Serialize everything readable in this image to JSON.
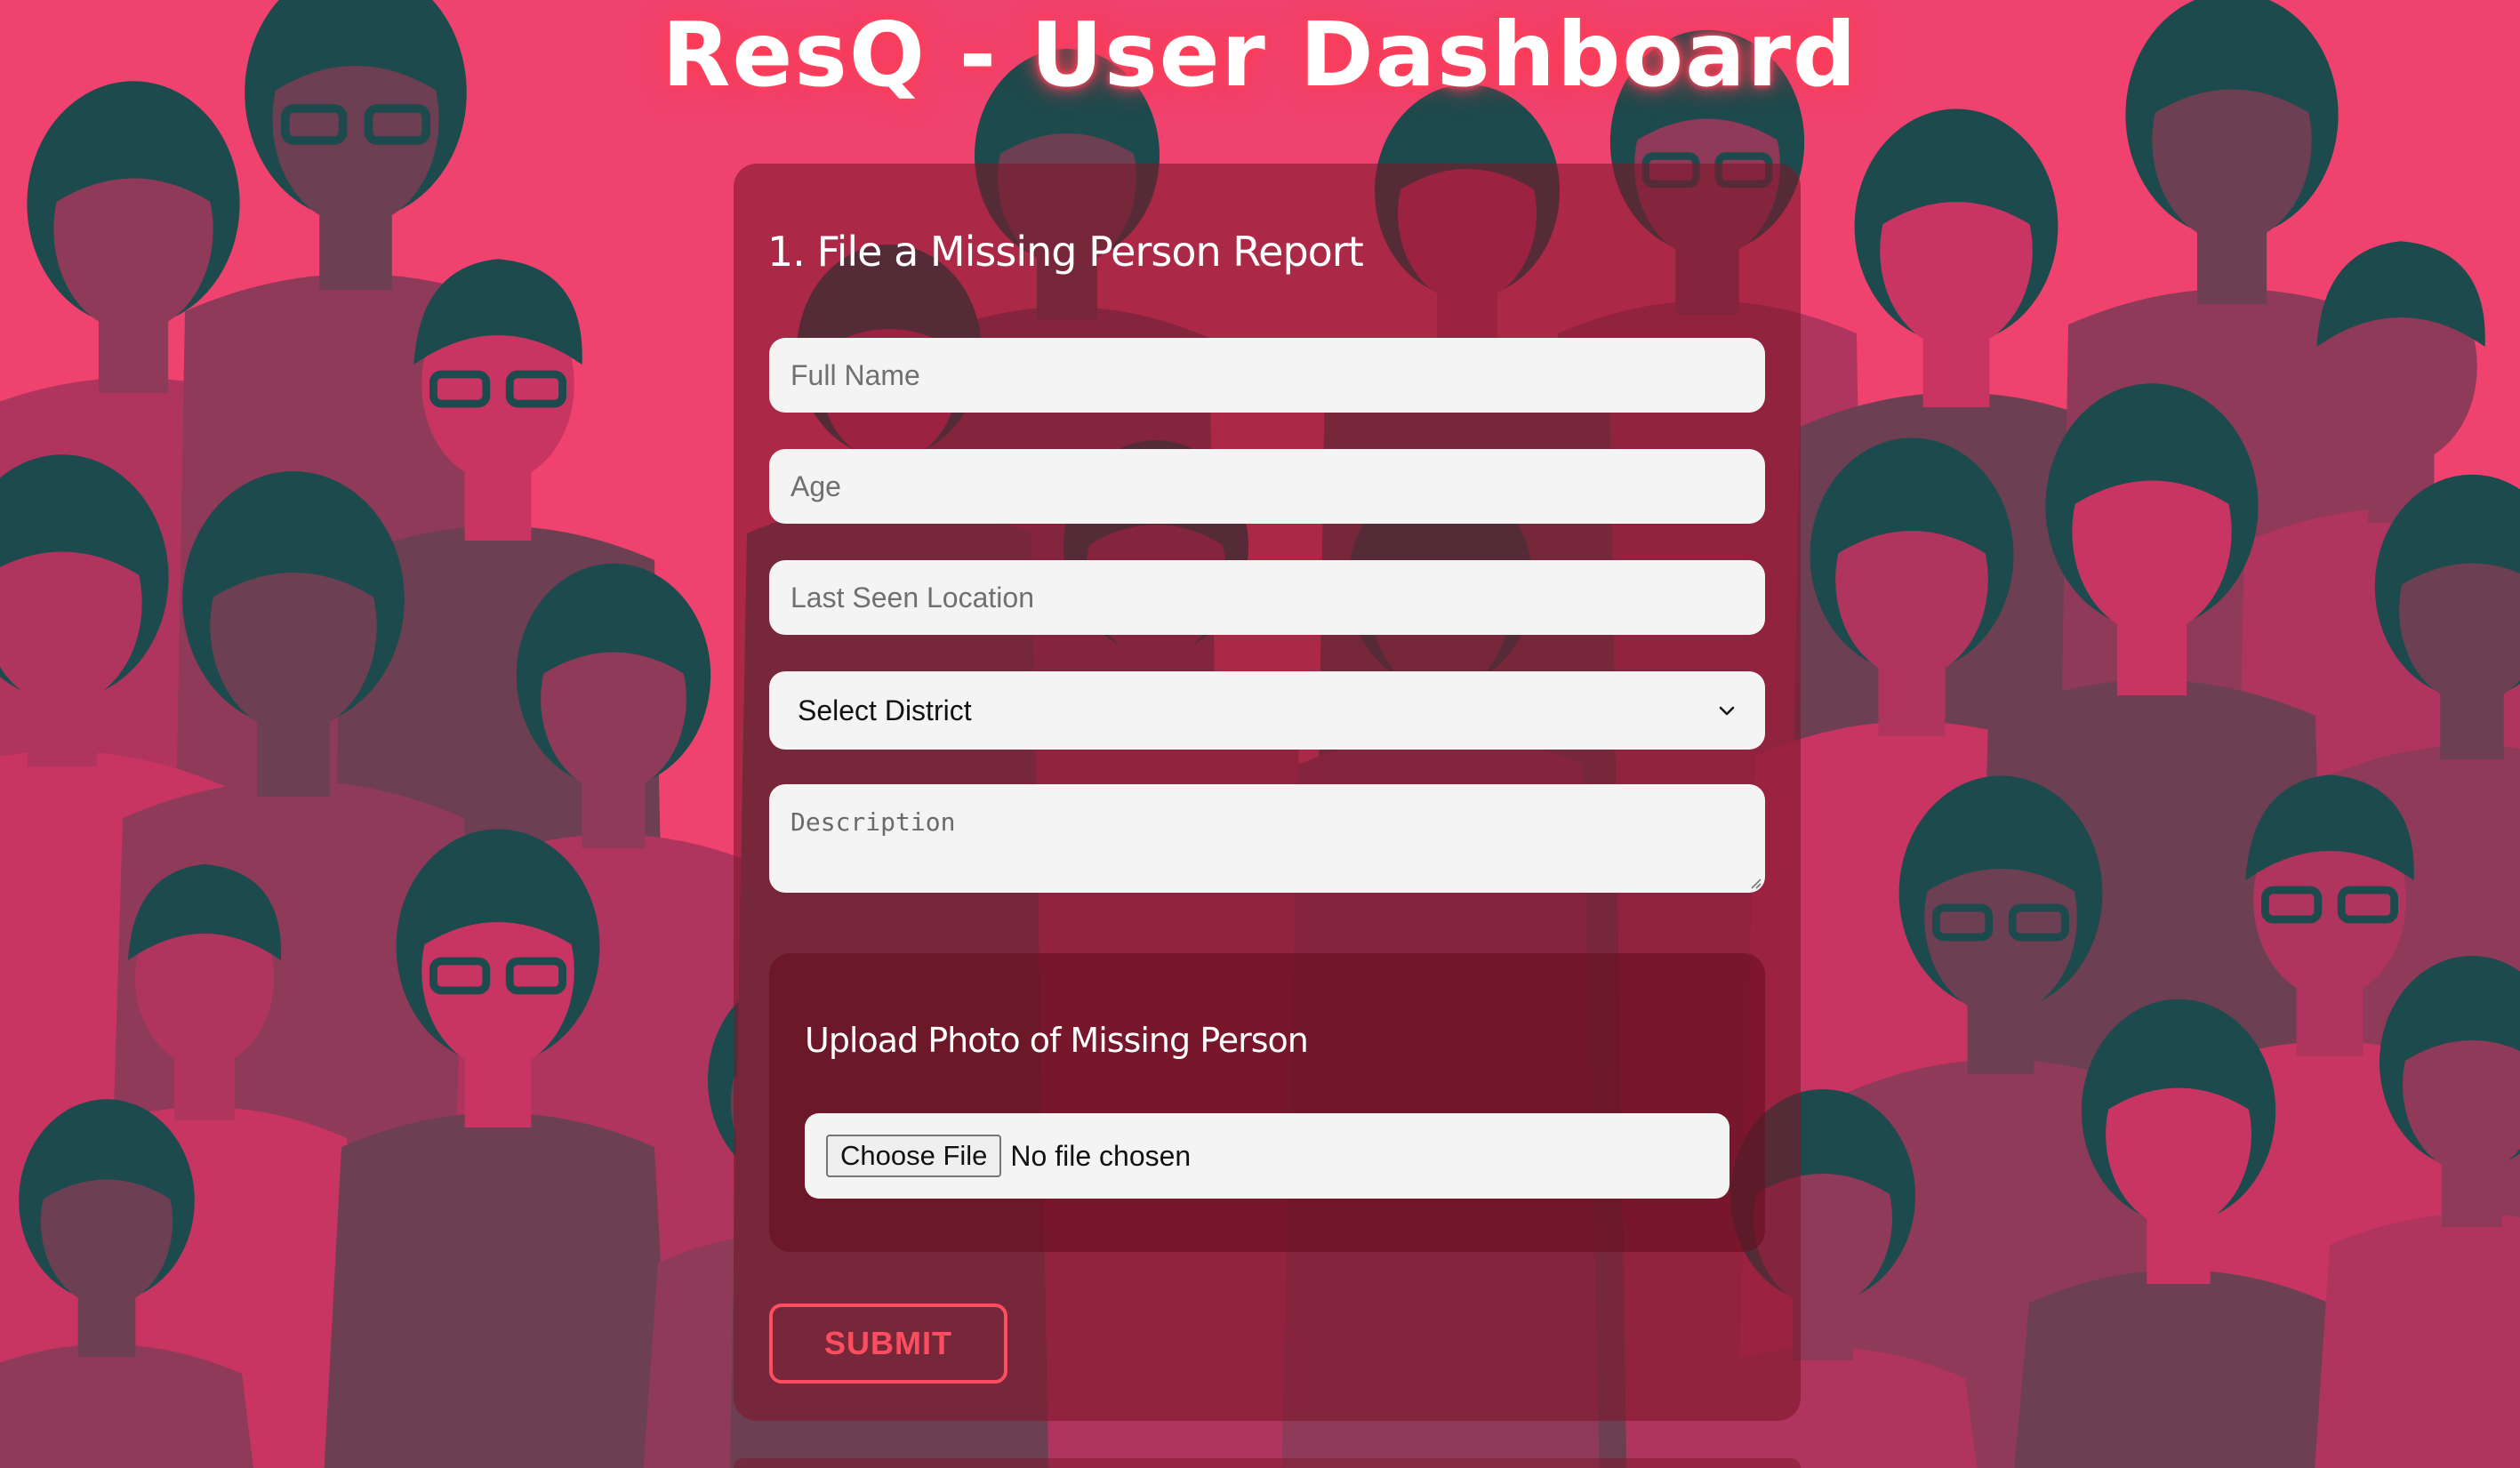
{
  "title": "ResQ - User Dashboard",
  "form": {
    "heading": "1. File a Missing Person Report",
    "full_name": {
      "placeholder": "Full Name",
      "value": ""
    },
    "age": {
      "placeholder": "Age",
      "value": ""
    },
    "last_seen_location": {
      "placeholder": "Last Seen Location",
      "value": ""
    },
    "district": {
      "selected": "Select District"
    },
    "description": {
      "placeholder": "Description",
      "value": ""
    },
    "upload": {
      "heading": "Upload Photo of Missing Person",
      "choose_button": "Choose File",
      "status": "No file chosen"
    },
    "submit_label": "SUBMIT"
  },
  "colors": {
    "background": "#f0426e",
    "figures_dark": "#1d4a4c",
    "card": "#7d182c",
    "submit_accent": "#ff4d60",
    "field_bg": "#f4f4f4"
  },
  "icons": {
    "district_dropdown": "chevron-down-icon",
    "textarea_resize": "resize-grip-icon"
  }
}
